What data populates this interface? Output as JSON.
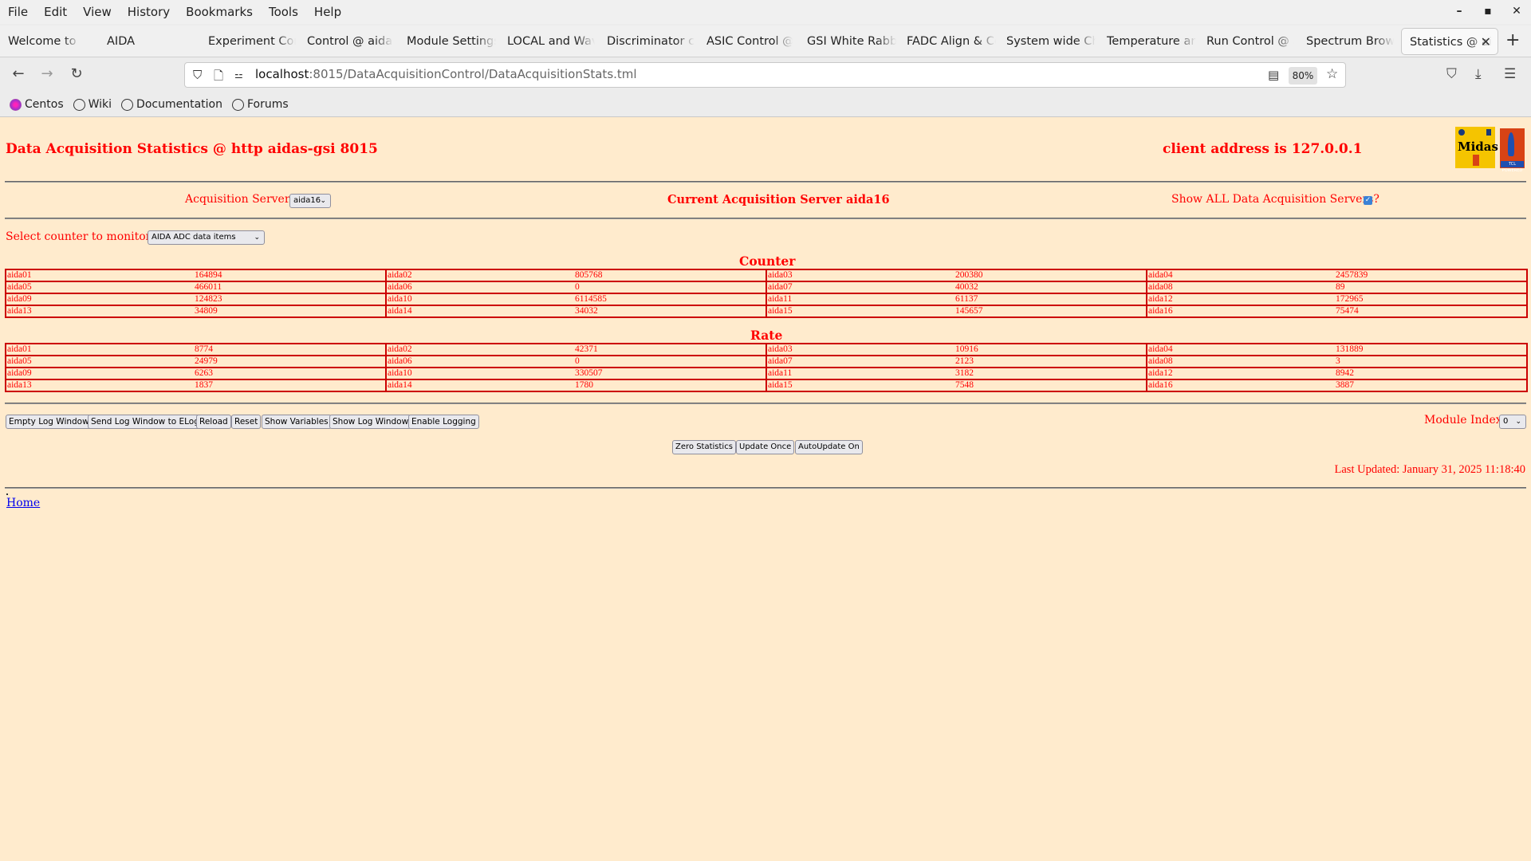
{
  "browser": {
    "menu": [
      "File",
      "Edit",
      "View",
      "History",
      "Bookmarks",
      "Tools",
      "Help"
    ],
    "window_controls": {
      "minimize": "–",
      "maximize": "▪",
      "close": "✕"
    },
    "tabs": [
      {
        "label": "Welcome to Centos"
      },
      {
        "label": "AIDA"
      },
      {
        "label": "Experiment Control"
      },
      {
        "label": "Control @ aidas"
      },
      {
        "label": "Module Settings"
      },
      {
        "label": "LOCAL and Wave"
      },
      {
        "label": "Discriminator control"
      },
      {
        "label": "ASIC Control @"
      },
      {
        "label": "GSI White Rabbit"
      },
      {
        "label": "FADC Align & Control"
      },
      {
        "label": "System wide Checks"
      },
      {
        "label": "Temperature and"
      },
      {
        "label": "Run Control @ a"
      },
      {
        "label": "Spectrum Browser"
      },
      {
        "label": "Statistics @ aidas",
        "active": true
      }
    ],
    "new_tab_label": "+",
    "url_host": "localhost",
    "url_rest": ":8015/DataAcquisitionControl/DataAcquisitionStats.tml",
    "zoom_level": "80%",
    "bookmarks": [
      {
        "label": "Centos",
        "icon": "centos-icon"
      },
      {
        "label": "Wiki",
        "icon": "globe-icon"
      },
      {
        "label": "Documentation",
        "icon": "globe-icon"
      },
      {
        "label": "Forums",
        "icon": "globe-icon"
      }
    ]
  },
  "page": {
    "title": "Data Acquisition Statistics @ http aidas-gsi 8015",
    "client_address": "client address is 127.0.0.1",
    "logos": {
      "midas": "Midas",
      "tcl": "TCL POWERED"
    },
    "servers": {
      "label": "Acquisition Servers",
      "selected": "aida16",
      "current_label": "Current Acquisition Server aida16",
      "show_all_label": "Show ALL Data Acquisition Servers?",
      "show_all_checked": true
    },
    "counter_select": {
      "label": "Select counter to monitor",
      "selected": "AIDA ADC data items"
    },
    "counter": {
      "heading": "Counter",
      "rows": [
        [
          [
            "aida01",
            "164894"
          ],
          [
            "aida02",
            "805768"
          ],
          [
            "aida03",
            "200380"
          ],
          [
            "aida04",
            "2457839"
          ]
        ],
        [
          [
            "aida05",
            "466011"
          ],
          [
            "aida06",
            "0"
          ],
          [
            "aida07",
            "40032"
          ],
          [
            "aida08",
            "89"
          ]
        ],
        [
          [
            "aida09",
            "124823"
          ],
          [
            "aida10",
            "6114585"
          ],
          [
            "aida11",
            "61137"
          ],
          [
            "aida12",
            "172965"
          ]
        ],
        [
          [
            "aida13",
            "34809"
          ],
          [
            "aida14",
            "34032"
          ],
          [
            "aida15",
            "145657"
          ],
          [
            "aida16",
            "75474"
          ]
        ]
      ]
    },
    "rate": {
      "heading": "Rate",
      "rows": [
        [
          [
            "aida01",
            "8774"
          ],
          [
            "aida02",
            "42371"
          ],
          [
            "aida03",
            "10916"
          ],
          [
            "aida04",
            "131889"
          ]
        ],
        [
          [
            "aida05",
            "24979"
          ],
          [
            "aida06",
            "0"
          ],
          [
            "aida07",
            "2123"
          ],
          [
            "aida08",
            "3"
          ]
        ],
        [
          [
            "aida09",
            "6263"
          ],
          [
            "aida10",
            "330507"
          ],
          [
            "aida11",
            "3182"
          ],
          [
            "aida12",
            "8942"
          ]
        ],
        [
          [
            "aida13",
            "1837"
          ],
          [
            "aida14",
            "1780"
          ],
          [
            "aida15",
            "7548"
          ],
          [
            "aida16",
            "3887"
          ]
        ]
      ]
    },
    "log_buttons": [
      "Empty Log Window",
      "Send Log Window to ELog",
      "Reload",
      "Reset",
      "Show Variables",
      "Show Log Window",
      "Enable Logging"
    ],
    "module_index": {
      "label": "Module Index",
      "selected": "0"
    },
    "stats_buttons": [
      "Zero Statistics",
      "Update Once",
      "AutoUpdate On"
    ],
    "last_updated": "Last Updated: January 31, 2025 11:18:40",
    "home_link": "Home"
  }
}
